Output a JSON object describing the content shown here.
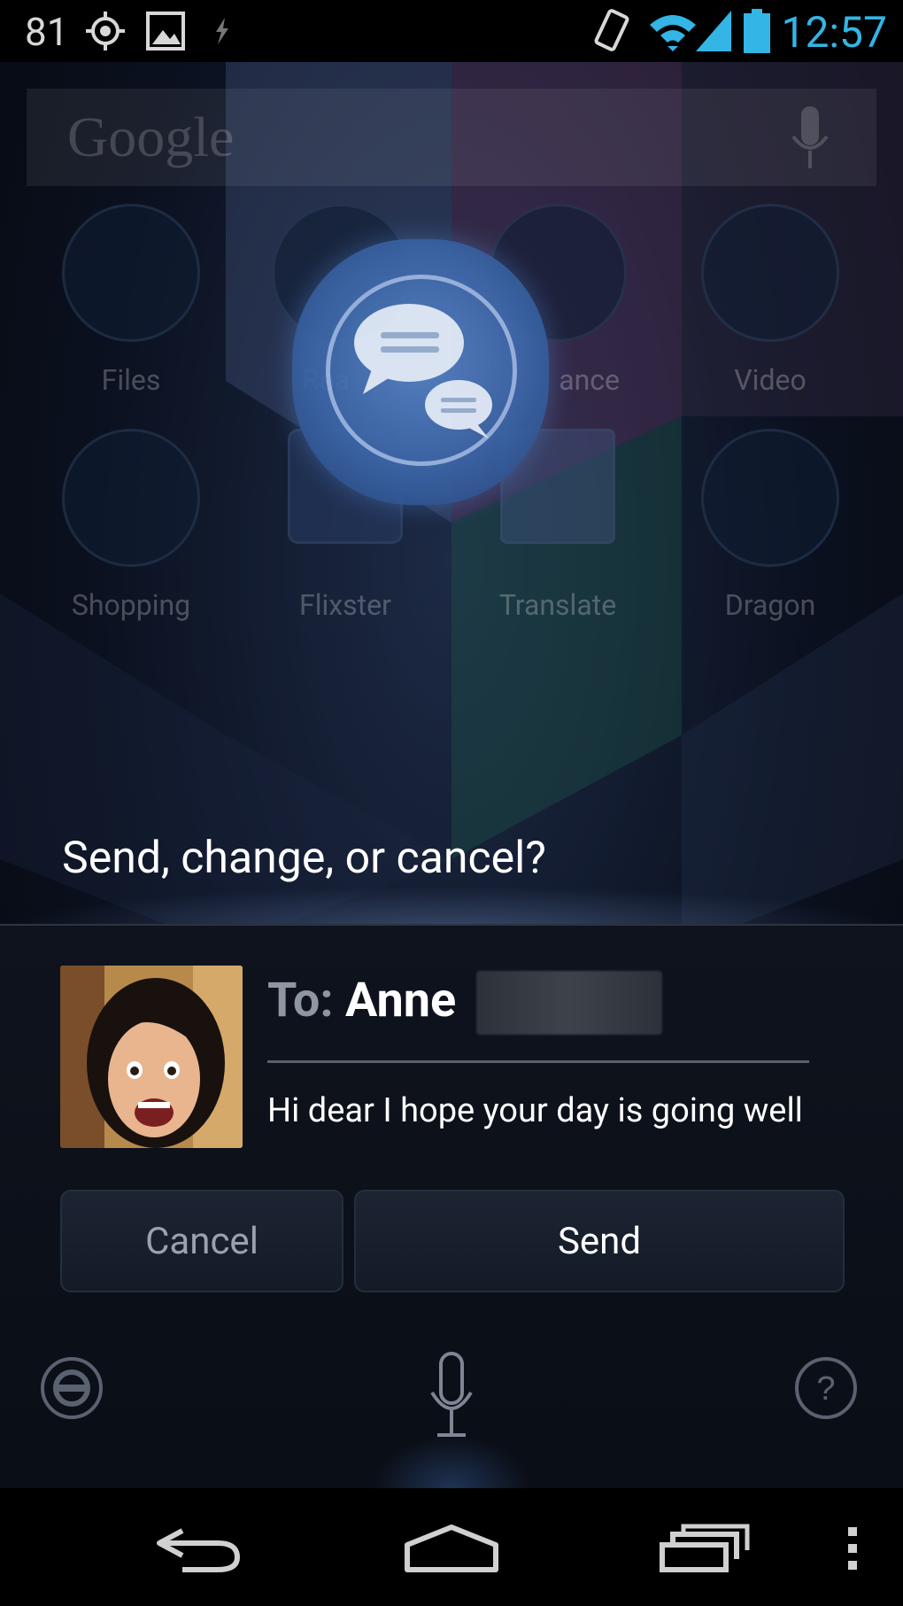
{
  "status_bar": {
    "left_number": "81",
    "time": "12:57"
  },
  "home_screen": {
    "search_logo": "Google",
    "apps": [
      {
        "label": "Files"
      },
      {
        "label": "Rea"
      },
      {
        "label": "ance"
      },
      {
        "label": "Video"
      },
      {
        "label": "Shopping"
      },
      {
        "label": "Flixster"
      },
      {
        "label": "Translate"
      },
      {
        "label": "Dragon"
      }
    ]
  },
  "voice_action": {
    "prompt": "Send, change, or cancel?",
    "to_label": "To:",
    "recipient_name": "Anne",
    "message": "Hi dear I hope your day is going well",
    "cancel_label": "Cancel",
    "send_label": "Send"
  },
  "colors": {
    "accent_blue": "#33b5e5",
    "card_bg": "#0e131d",
    "button_bg": "#1a2230"
  },
  "icons": {
    "status": [
      "gps-icon",
      "image-icon",
      "notification-icon",
      "vibrate-icon",
      "wifi-icon",
      "signal-icon",
      "battery-icon"
    ],
    "voice": [
      "car-mode-icon",
      "microphone-icon",
      "help-icon"
    ],
    "nav": [
      "back-icon",
      "home-icon",
      "recents-icon",
      "menu-icon"
    ]
  }
}
